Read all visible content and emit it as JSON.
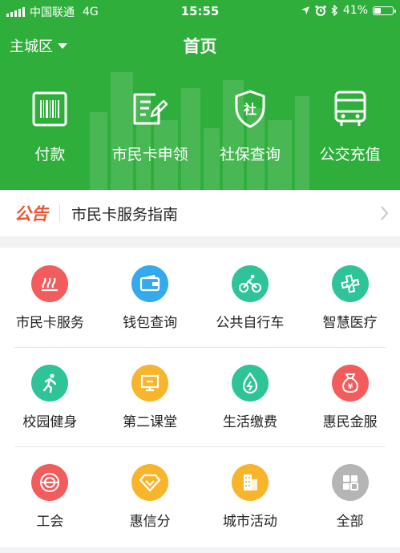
{
  "status_bar": {
    "carrier": "中国联通",
    "network": "4G",
    "time": "15:55",
    "battery": "41%",
    "battery_level": 0.41
  },
  "nav": {
    "district": "主城区",
    "title": "首页"
  },
  "quick_actions": [
    {
      "label": "付款",
      "icon": "barcode-icon"
    },
    {
      "label": "市民卡申领",
      "icon": "apply-form-icon"
    },
    {
      "label": "社保查询",
      "icon": "social-security-shield-icon"
    },
    {
      "label": "公交充值",
      "icon": "bus-icon"
    }
  ],
  "notice": {
    "tag": "公告",
    "text": "市民卡服务指南"
  },
  "services": [
    [
      {
        "label": "市民卡服务",
        "icon": "citizen-card-service-icon",
        "color": "#f25c5c"
      },
      {
        "label": "钱包查询",
        "icon": "wallet-icon",
        "color": "#35a9ee"
      },
      {
        "label": "公共自行车",
        "icon": "bicycle-icon",
        "color": "#2fc39a"
      },
      {
        "label": "智慧医疗",
        "icon": "medical-icon",
        "color": "#2fc39a"
      }
    ],
    [
      {
        "label": "校园健身",
        "icon": "running-icon",
        "color": "#2fc39a"
      },
      {
        "label": "第二课堂",
        "icon": "classroom-board-icon",
        "color": "#f7b52c"
      },
      {
        "label": "生活缴费",
        "icon": "utility-payment-icon",
        "color": "#2fc39a"
      },
      {
        "label": "惠民金服",
        "icon": "money-bag-icon",
        "color": "#f25c5c"
      }
    ],
    [
      {
        "label": "工会",
        "icon": "trade-union-icon",
        "color": "#f25c5c"
      },
      {
        "label": "惠信分",
        "icon": "credit-diamond-icon",
        "color": "#f7b52c"
      },
      {
        "label": "城市活动",
        "icon": "city-building-icon",
        "color": "#f7b52c"
      },
      {
        "label": "全部",
        "icon": "all-grid-icon",
        "color": "#b5b5b5"
      }
    ]
  ]
}
